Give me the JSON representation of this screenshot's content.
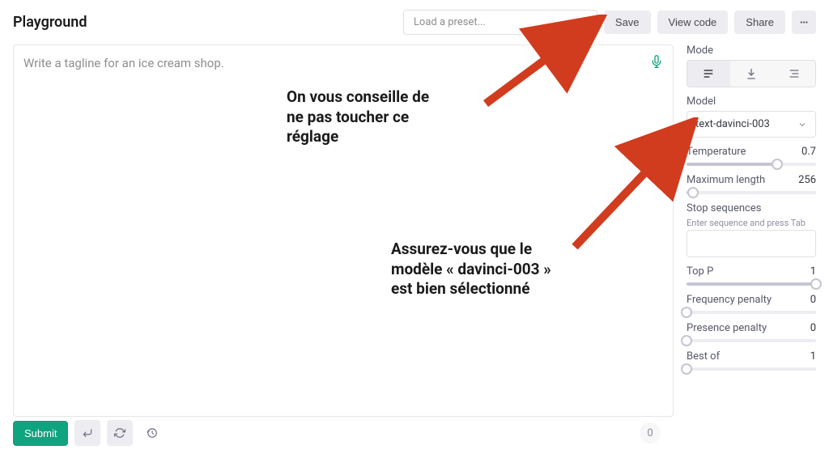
{
  "header": {
    "title": "Playground",
    "preset_placeholder": "Load a preset...",
    "save": "Save",
    "view_code": "View code",
    "share": "Share"
  },
  "editor": {
    "placeholder": "Write a tagline for an ice cream shop."
  },
  "sidebar": {
    "mode_label": "Mode",
    "model_label": "Model",
    "model_value": "text-davinci-003",
    "temperature": {
      "label": "Temperature",
      "value": "0.7",
      "percent": 70
    },
    "max_length": {
      "label": "Maximum length",
      "value": "256",
      "percent": 5
    },
    "stop": {
      "label": "Stop sequences",
      "hint": "Enter sequence and press Tab"
    },
    "top_p": {
      "label": "Top P",
      "value": "1",
      "percent": 100
    },
    "freq_pen": {
      "label": "Frequency penalty",
      "value": "0",
      "percent": 0
    },
    "pres_pen": {
      "label": "Presence penalty",
      "value": "0",
      "percent": 0
    },
    "best_of": {
      "label": "Best of",
      "value": "1",
      "percent": 0
    }
  },
  "footer": {
    "submit": "Submit",
    "token_count": "0"
  },
  "annotations": {
    "a1": "On vous conseille de\nne pas toucher ce\nréglage",
    "a2": "Assurez-vous que le\nmodèle « davinci-003 »\nest bien sélectionné"
  }
}
